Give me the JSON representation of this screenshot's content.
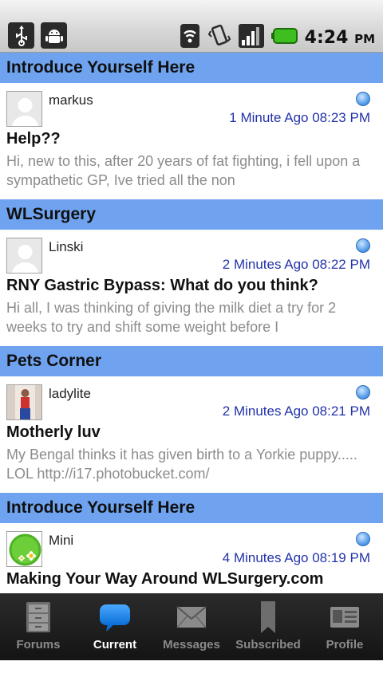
{
  "status_bar": {
    "icons": [
      "usb-icon",
      "android-debug-icon",
      "wifi-icon",
      "vibrate-icon",
      "signal-icon",
      "battery-icon"
    ],
    "time": "4:24",
    "ampm": "PM"
  },
  "topics": [
    {
      "forum": "Introduce Yourself Here",
      "author": "markus",
      "time": "1 Minute Ago 08:23 PM",
      "title": "Help??",
      "snippet": "Hi, new to this, after 20 years of fat fighting, i fell upon a sympathetic GP, Ive tried all the non"
    },
    {
      "forum": "WLSurgery",
      "author": "Linski",
      "time": "2 Minutes Ago 08:22 PM",
      "title": "RNY Gastric Bypass: What do you think?",
      "snippet": "Hi all,   I was thinking of giving the milk diet a try for 2 weeks to try and shift some weight before I"
    },
    {
      "forum": "Pets Corner",
      "author": "ladylite",
      "time": "2 Minutes Ago 08:21 PM",
      "title": "Motherly luv",
      "snippet": "My Bengal thinks it has given birth to a Yorkie puppy..... LOL   http://i17.photobucket.com/"
    },
    {
      "forum": "Introduce Yourself Here",
      "author": "Mini",
      "time": "4 Minutes Ago 08:19 PM",
      "title": "Making Your Way Around WLSurgery.com",
      "snippet": ""
    }
  ],
  "tabs": [
    {
      "label": "Forums",
      "icon": "cabinet-icon"
    },
    {
      "label": "Current",
      "icon": "speech-bubble-icon"
    },
    {
      "label": "Messages",
      "icon": "envelope-icon"
    },
    {
      "label": "Subscribed",
      "icon": "bookmark-icon"
    },
    {
      "label": "Profile",
      "icon": "id-card-icon"
    }
  ],
  "active_tab": "Current",
  "colors": {
    "forum_header": "#6fa3ef",
    "timestamp": "#2233aa",
    "snippet": "#8c8c8c",
    "tabbar": "#1e1e1e"
  }
}
